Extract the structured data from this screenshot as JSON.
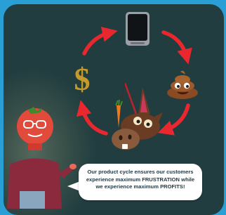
{
  "cycle": {
    "nodes": [
      "phone-icon",
      "poop-emoji-icon",
      "donkey-with-carrot-icon",
      "dollar-sign-icon"
    ],
    "arrow_color": "#e8272e",
    "dollar_color": "#c49a2a"
  },
  "character": {
    "description_icon": "tomato-head-presenter-icon",
    "head_color": "#e24a3b",
    "shirt_color": "#8b2a3c",
    "jeans_color": "#8aa6bf"
  },
  "speech_bubble": {
    "line1": "Our product cycle ensures our customers",
    "line2_pre": "experience maximum ",
    "line2_em": "FRUSTRATION",
    "line2_post": " while",
    "line3_pre": "we experience maximum ",
    "line3_em": "PROFITS",
    "line3_post": "!"
  },
  "colors": {
    "frame": "#2a9fd6",
    "panel": "#213d3f"
  }
}
